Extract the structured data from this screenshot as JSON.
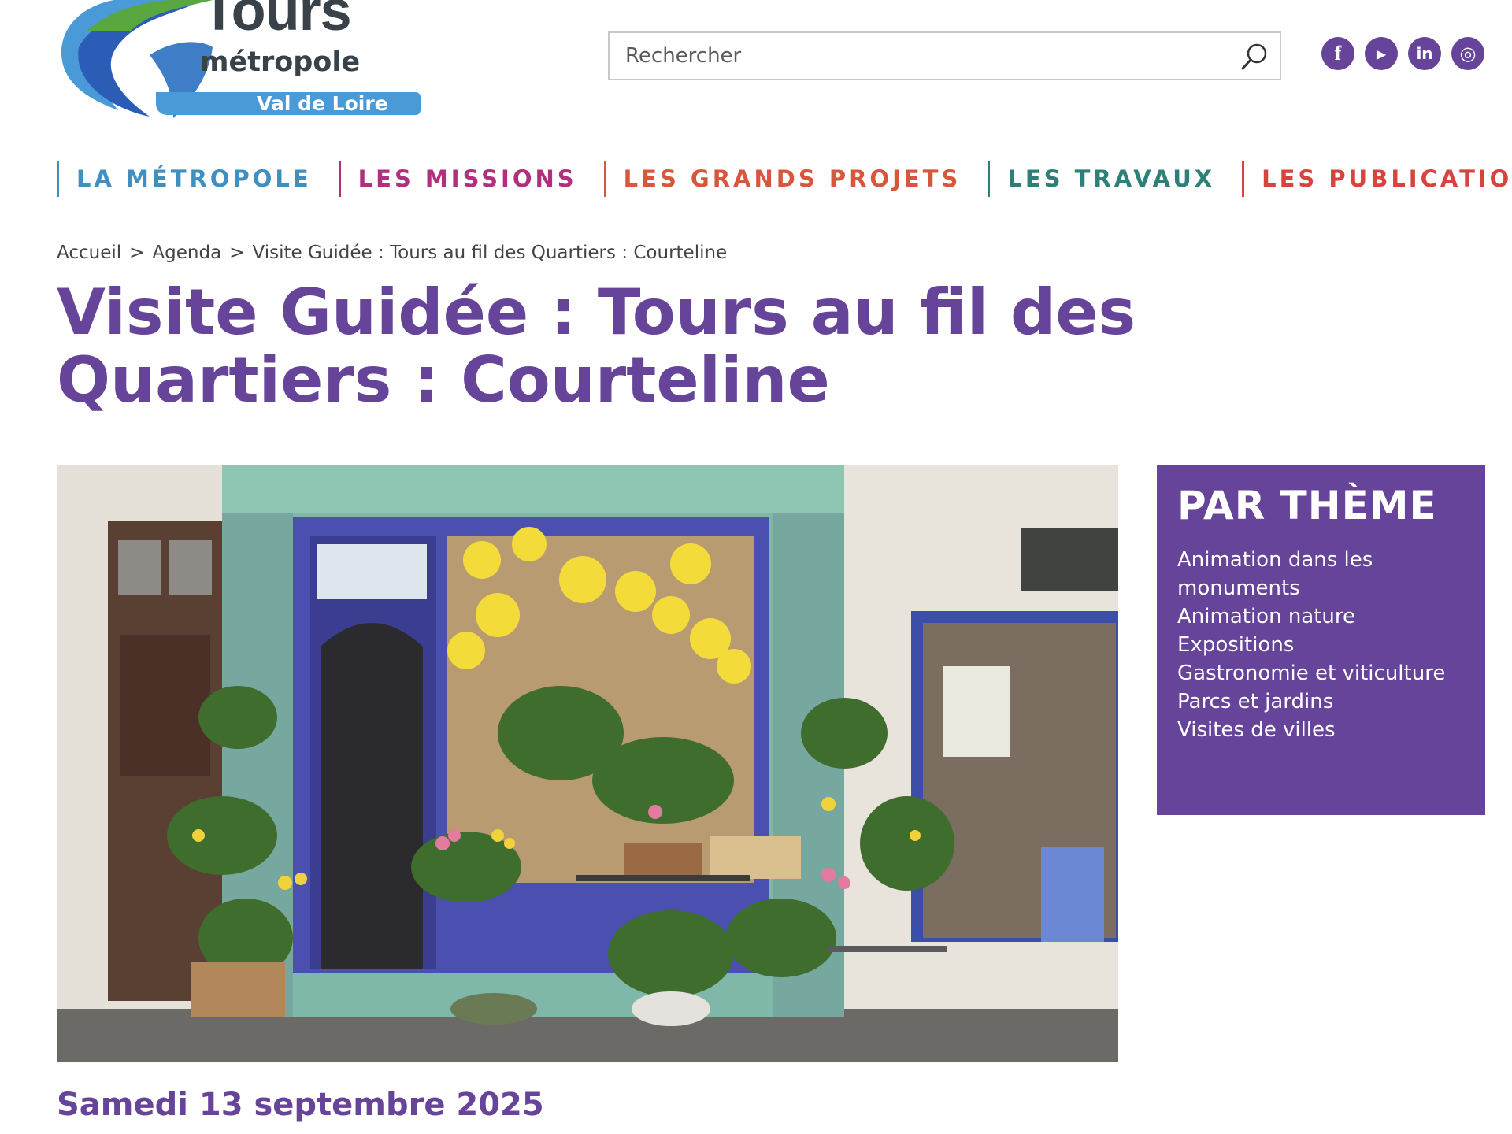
{
  "header": {
    "logo": {
      "line1": "Tours",
      "line2": "métropole",
      "line3": "Val de Loire"
    },
    "search": {
      "placeholder": "Rechercher"
    },
    "socials": [
      {
        "name": "facebook",
        "glyph": "f"
      },
      {
        "name": "youtube",
        "glyph": "▶"
      },
      {
        "name": "linkedin",
        "glyph": "in"
      },
      {
        "name": "instagram",
        "glyph": "◎"
      }
    ]
  },
  "nav": {
    "items": [
      {
        "label": "La métropole",
        "color": "#3f8fc0"
      },
      {
        "label": "Les missions",
        "color": "#b0307e"
      },
      {
        "label": "Les grands projets",
        "color": "#d7573c"
      },
      {
        "label": "Les travaux",
        "color": "#2d8077"
      },
      {
        "label": "Les publications",
        "color": "#d7443e"
      }
    ]
  },
  "breadcrumb": {
    "home": "Accueil",
    "sep": ">",
    "agenda": "Agenda",
    "current": "Visite Guidée : Tours au fil des Quartiers : Courteline"
  },
  "page": {
    "title": "Visite Guidée : Tours au fil des Quartiers : Courteline",
    "date": "Samedi 13 septembre 2025"
  },
  "sidebar": {
    "title": "PAR THÈME",
    "themes": [
      "Animation dans les monuments",
      "Animation nature",
      "Expositions",
      "Gastronomie et viticulture",
      "Parcs et jardins",
      "Visites de villes"
    ]
  },
  "colors": {
    "brand_purple": "#66449a",
    "logo_blue": "#4a9ad8",
    "logo_green": "#5aa640"
  }
}
